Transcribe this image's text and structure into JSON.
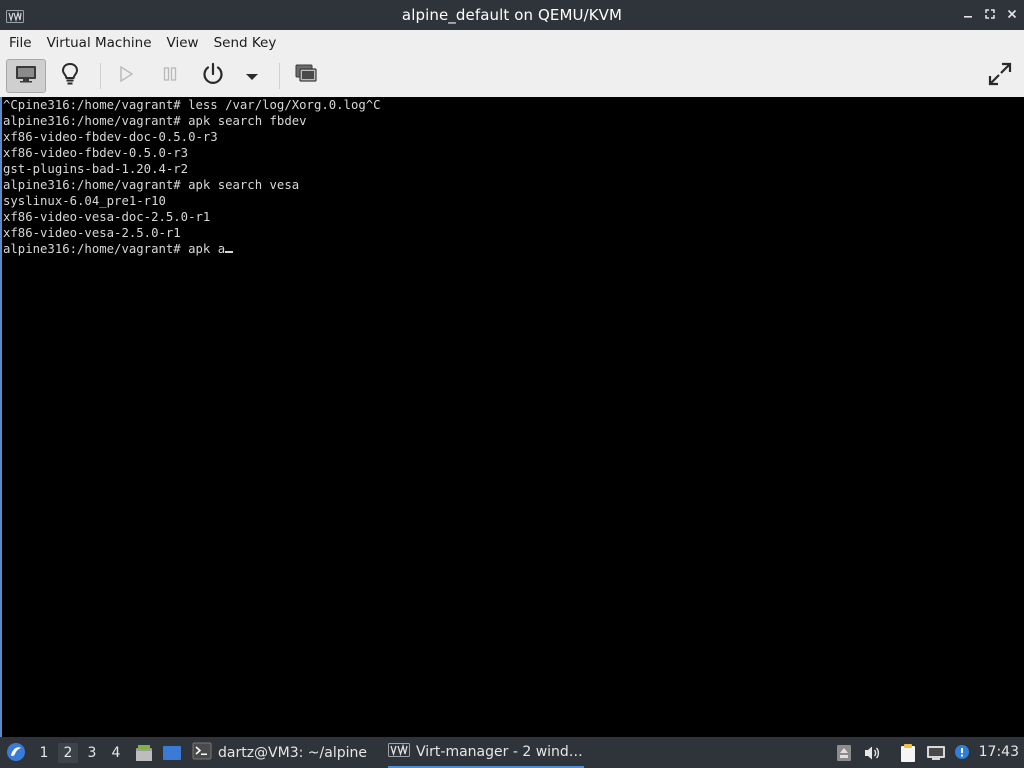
{
  "window": {
    "title": "alpine_default on QEMU/KVM",
    "app_icon": "virt-manager-icon",
    "controls": [
      "minimize-icon",
      "maximize-icon",
      "close-icon"
    ]
  },
  "menubar": {
    "items": [
      {
        "label": "File"
      },
      {
        "label": "Virtual Machine"
      },
      {
        "label": "View"
      },
      {
        "label": "Send Key"
      }
    ]
  },
  "toolbar": {
    "buttons": [
      {
        "name": "console-view-button",
        "icon": "monitor-icon",
        "active": true
      },
      {
        "name": "details-view-button",
        "icon": "lightbulb-icon"
      },
      {
        "name": "run-button",
        "icon": "play-icon",
        "disabled": true
      },
      {
        "name": "pause-button",
        "icon": "pause-icon",
        "disabled": true
      },
      {
        "name": "shutdown-button",
        "icon": "power-icon"
      },
      {
        "name": "shutdown-menu-button",
        "icon": "chevron-down-icon"
      },
      {
        "name": "snapshots-button",
        "icon": "snapshots-icon"
      },
      {
        "name": "fullscreen-button",
        "icon": "fullscreen-icon"
      }
    ]
  },
  "console": {
    "lines": [
      "^Cpine316:/home/vagrant# less /var/log/Xorg.0.log^C",
      "alpine316:/home/vagrant# apk search fbdev",
      "xf86-video-fbdev-doc-0.5.0-r3",
      "xf86-video-fbdev-0.5.0-r3",
      "gst-plugins-bad-1.20.4-r2",
      "alpine316:/home/vagrant# apk search vesa",
      "syslinux-6.04_pre1-r10",
      "xf86-video-vesa-doc-2.5.0-r1",
      "xf86-video-vesa-2.5.0-r1",
      "alpine316:/home/vagrant# apk a"
    ],
    "colors": {
      "background": "#000000",
      "text": "#d8d8d8"
    }
  },
  "taskbar": {
    "workspaces": [
      "1",
      "2",
      "3",
      "4"
    ],
    "current_workspace": "2",
    "tasks": [
      {
        "label": "dartz@VM3: ~/alpine",
        "icon": "terminal-icon"
      },
      {
        "label": "Virt-manager - 2 wind…",
        "icon": "virt-manager-icon",
        "active": true
      }
    ],
    "tray_icons": [
      "software-updates-icon",
      "volume-icon",
      "clipboard-icon",
      "network-icon",
      "notification-icon"
    ],
    "clock": "17:43"
  },
  "colors": {
    "titlebar": "#2f343a",
    "taskbar": "#2f343a",
    "accent": "#4a90d9"
  }
}
